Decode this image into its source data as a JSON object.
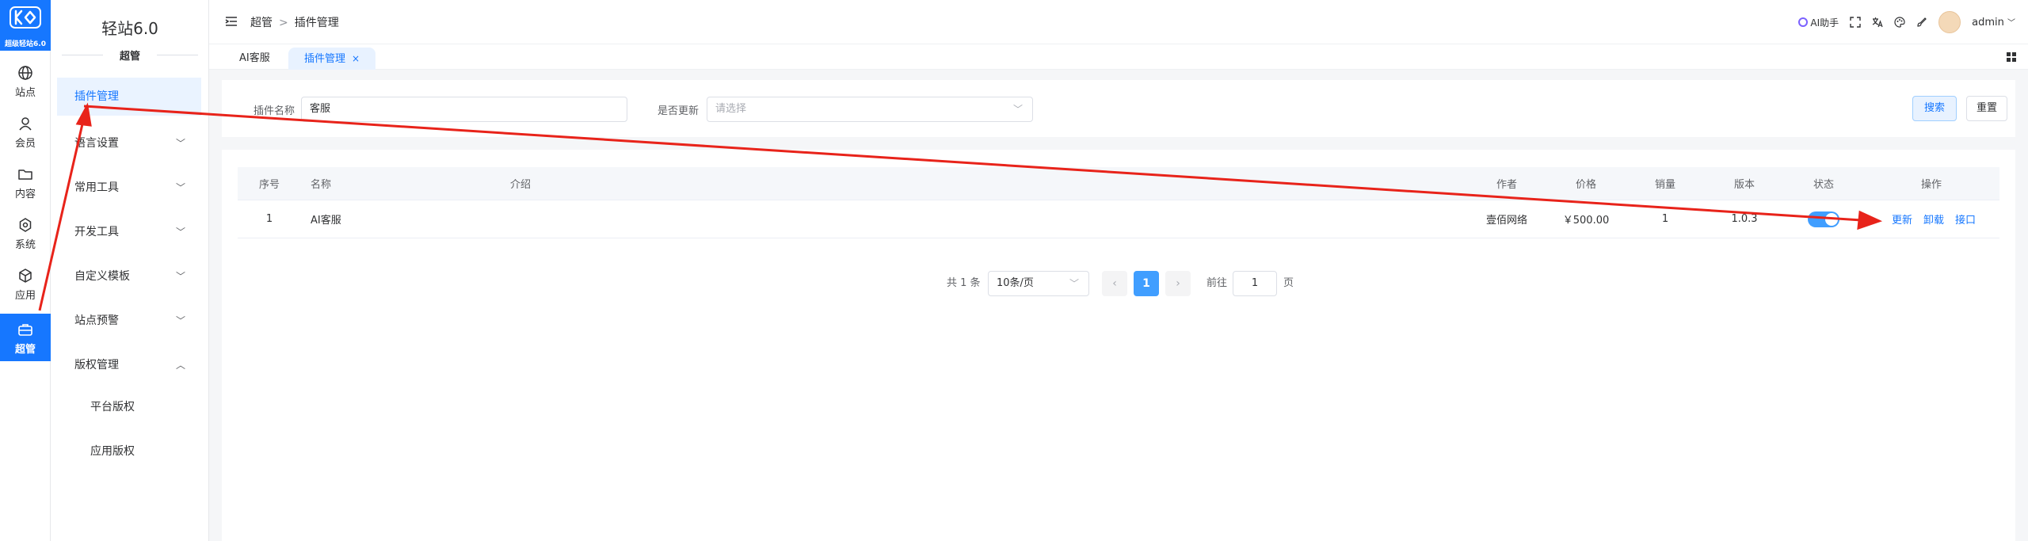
{
  "logo": {
    "caption": "超级轻站6.0"
  },
  "rail": [
    {
      "label": "站点",
      "icon": "globe-icon"
    },
    {
      "label": "会员",
      "icon": "user-icon"
    },
    {
      "label": "内容",
      "icon": "folder-icon"
    },
    {
      "label": "系统",
      "icon": "gear-icon"
    },
    {
      "label": "应用",
      "icon": "cube-icon"
    },
    {
      "label": "超管",
      "icon": "briefcase-icon"
    }
  ],
  "sidebar": {
    "title": "轻站6.0",
    "subtitle": "超管",
    "items": [
      {
        "label": "插件管理"
      },
      {
        "label": "语言设置"
      },
      {
        "label": "常用工具"
      },
      {
        "label": "开发工具"
      },
      {
        "label": "自定义模板"
      },
      {
        "label": "站点预警"
      },
      {
        "label": "版权管理"
      },
      {
        "label": "平台版权"
      },
      {
        "label": "应用版权"
      }
    ]
  },
  "breadcrumb": {
    "root": "超管",
    "separator": ">",
    "current": "插件管理"
  },
  "toolbar": {
    "ai_label": "AI助手",
    "user": "admin"
  },
  "tabs": [
    {
      "label": "AI客服"
    },
    {
      "label": "插件管理",
      "close": "×"
    }
  ],
  "search": {
    "name_label": "插件名称",
    "name_value": "客服",
    "update_label": "是否更新",
    "update_placeholder": "请选择",
    "search_btn": "搜索",
    "reset_btn": "重置"
  },
  "table": {
    "headers": [
      "序号",
      "名称",
      "介绍",
      "作者",
      "价格",
      "销量",
      "版本",
      "状态",
      "操作"
    ],
    "rows": [
      {
        "index": "1",
        "name": "AI客服",
        "intro": "",
        "author": "壹佰网络",
        "price": "￥500.00",
        "sales": "1",
        "version": "1.0.3",
        "enabled": true,
        "actions": [
          "更新",
          "卸载",
          "接口"
        ]
      }
    ]
  },
  "pagination": {
    "total": "共 1 条",
    "page_size": "10条/页",
    "current": "1",
    "goto_label": "前往",
    "goto_value": "1",
    "unit": "页"
  },
  "colors": {
    "primary": "#1677ff",
    "annotation": "#e8231a"
  }
}
